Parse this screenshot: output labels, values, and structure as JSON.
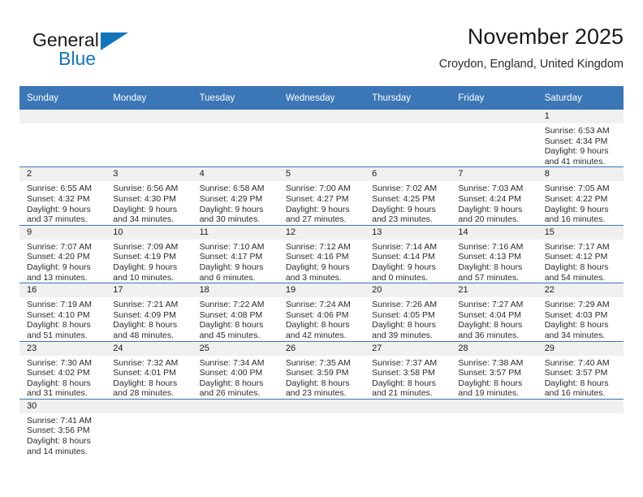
{
  "brand": {
    "name_line1": "General",
    "name_line2": "Blue",
    "accent_color": "#1275bc"
  },
  "header": {
    "title": "November 2025",
    "location": "Croydon, England, United Kingdom"
  },
  "theme": {
    "header_blue": "#3b76b6",
    "daynum_band": "#f0f0f0",
    "text": "#2b2b2b"
  },
  "weekdays": [
    "Sunday",
    "Monday",
    "Tuesday",
    "Wednesday",
    "Thursday",
    "Friday",
    "Saturday"
  ],
  "labels": {
    "sunrise": "Sunrise:",
    "sunset": "Sunset:",
    "daylight": "Daylight:"
  },
  "weeks": [
    [
      {
        "day": "",
        "sunrise": "",
        "sunset": "",
        "daylight_a": "",
        "daylight_b": ""
      },
      {
        "day": "",
        "sunrise": "",
        "sunset": "",
        "daylight_a": "",
        "daylight_b": ""
      },
      {
        "day": "",
        "sunrise": "",
        "sunset": "",
        "daylight_a": "",
        "daylight_b": ""
      },
      {
        "day": "",
        "sunrise": "",
        "sunset": "",
        "daylight_a": "",
        "daylight_b": ""
      },
      {
        "day": "",
        "sunrise": "",
        "sunset": "",
        "daylight_a": "",
        "daylight_b": ""
      },
      {
        "day": "",
        "sunrise": "",
        "sunset": "",
        "daylight_a": "",
        "daylight_b": ""
      },
      {
        "day": "1",
        "sunrise": "Sunrise: 6:53 AM",
        "sunset": "Sunset: 4:34 PM",
        "daylight_a": "Daylight: 9 hours",
        "daylight_b": "and 41 minutes."
      }
    ],
    [
      {
        "day": "2",
        "sunrise": "Sunrise: 6:55 AM",
        "sunset": "Sunset: 4:32 PM",
        "daylight_a": "Daylight: 9 hours",
        "daylight_b": "and 37 minutes."
      },
      {
        "day": "3",
        "sunrise": "Sunrise: 6:56 AM",
        "sunset": "Sunset: 4:30 PM",
        "daylight_a": "Daylight: 9 hours",
        "daylight_b": "and 34 minutes."
      },
      {
        "day": "4",
        "sunrise": "Sunrise: 6:58 AM",
        "sunset": "Sunset: 4:29 PM",
        "daylight_a": "Daylight: 9 hours",
        "daylight_b": "and 30 minutes."
      },
      {
        "day": "5",
        "sunrise": "Sunrise: 7:00 AM",
        "sunset": "Sunset: 4:27 PM",
        "daylight_a": "Daylight: 9 hours",
        "daylight_b": "and 27 minutes."
      },
      {
        "day": "6",
        "sunrise": "Sunrise: 7:02 AM",
        "sunset": "Sunset: 4:25 PM",
        "daylight_a": "Daylight: 9 hours",
        "daylight_b": "and 23 minutes."
      },
      {
        "day": "7",
        "sunrise": "Sunrise: 7:03 AM",
        "sunset": "Sunset: 4:24 PM",
        "daylight_a": "Daylight: 9 hours",
        "daylight_b": "and 20 minutes."
      },
      {
        "day": "8",
        "sunrise": "Sunrise: 7:05 AM",
        "sunset": "Sunset: 4:22 PM",
        "daylight_a": "Daylight: 9 hours",
        "daylight_b": "and 16 minutes."
      }
    ],
    [
      {
        "day": "9",
        "sunrise": "Sunrise: 7:07 AM",
        "sunset": "Sunset: 4:20 PM",
        "daylight_a": "Daylight: 9 hours",
        "daylight_b": "and 13 minutes."
      },
      {
        "day": "10",
        "sunrise": "Sunrise: 7:09 AM",
        "sunset": "Sunset: 4:19 PM",
        "daylight_a": "Daylight: 9 hours",
        "daylight_b": "and 10 minutes."
      },
      {
        "day": "11",
        "sunrise": "Sunrise: 7:10 AM",
        "sunset": "Sunset: 4:17 PM",
        "daylight_a": "Daylight: 9 hours",
        "daylight_b": "and 6 minutes."
      },
      {
        "day": "12",
        "sunrise": "Sunrise: 7:12 AM",
        "sunset": "Sunset: 4:16 PM",
        "daylight_a": "Daylight: 9 hours",
        "daylight_b": "and 3 minutes."
      },
      {
        "day": "13",
        "sunrise": "Sunrise: 7:14 AM",
        "sunset": "Sunset: 4:14 PM",
        "daylight_a": "Daylight: 9 hours",
        "daylight_b": "and 0 minutes."
      },
      {
        "day": "14",
        "sunrise": "Sunrise: 7:16 AM",
        "sunset": "Sunset: 4:13 PM",
        "daylight_a": "Daylight: 8 hours",
        "daylight_b": "and 57 minutes."
      },
      {
        "day": "15",
        "sunrise": "Sunrise: 7:17 AM",
        "sunset": "Sunset: 4:12 PM",
        "daylight_a": "Daylight: 8 hours",
        "daylight_b": "and 54 minutes."
      }
    ],
    [
      {
        "day": "16",
        "sunrise": "Sunrise: 7:19 AM",
        "sunset": "Sunset: 4:10 PM",
        "daylight_a": "Daylight: 8 hours",
        "daylight_b": "and 51 minutes."
      },
      {
        "day": "17",
        "sunrise": "Sunrise: 7:21 AM",
        "sunset": "Sunset: 4:09 PM",
        "daylight_a": "Daylight: 8 hours",
        "daylight_b": "and 48 minutes."
      },
      {
        "day": "18",
        "sunrise": "Sunrise: 7:22 AM",
        "sunset": "Sunset: 4:08 PM",
        "daylight_a": "Daylight: 8 hours",
        "daylight_b": "and 45 minutes."
      },
      {
        "day": "19",
        "sunrise": "Sunrise: 7:24 AM",
        "sunset": "Sunset: 4:06 PM",
        "daylight_a": "Daylight: 8 hours",
        "daylight_b": "and 42 minutes."
      },
      {
        "day": "20",
        "sunrise": "Sunrise: 7:26 AM",
        "sunset": "Sunset: 4:05 PM",
        "daylight_a": "Daylight: 8 hours",
        "daylight_b": "and 39 minutes."
      },
      {
        "day": "21",
        "sunrise": "Sunrise: 7:27 AM",
        "sunset": "Sunset: 4:04 PM",
        "daylight_a": "Daylight: 8 hours",
        "daylight_b": "and 36 minutes."
      },
      {
        "day": "22",
        "sunrise": "Sunrise: 7:29 AM",
        "sunset": "Sunset: 4:03 PM",
        "daylight_a": "Daylight: 8 hours",
        "daylight_b": "and 34 minutes."
      }
    ],
    [
      {
        "day": "23",
        "sunrise": "Sunrise: 7:30 AM",
        "sunset": "Sunset: 4:02 PM",
        "daylight_a": "Daylight: 8 hours",
        "daylight_b": "and 31 minutes."
      },
      {
        "day": "24",
        "sunrise": "Sunrise: 7:32 AM",
        "sunset": "Sunset: 4:01 PM",
        "daylight_a": "Daylight: 8 hours",
        "daylight_b": "and 28 minutes."
      },
      {
        "day": "25",
        "sunrise": "Sunrise: 7:34 AM",
        "sunset": "Sunset: 4:00 PM",
        "daylight_a": "Daylight: 8 hours",
        "daylight_b": "and 26 minutes."
      },
      {
        "day": "26",
        "sunrise": "Sunrise: 7:35 AM",
        "sunset": "Sunset: 3:59 PM",
        "daylight_a": "Daylight: 8 hours",
        "daylight_b": "and 23 minutes."
      },
      {
        "day": "27",
        "sunrise": "Sunrise: 7:37 AM",
        "sunset": "Sunset: 3:58 PM",
        "daylight_a": "Daylight: 8 hours",
        "daylight_b": "and 21 minutes."
      },
      {
        "day": "28",
        "sunrise": "Sunrise: 7:38 AM",
        "sunset": "Sunset: 3:57 PM",
        "daylight_a": "Daylight: 8 hours",
        "daylight_b": "and 19 minutes."
      },
      {
        "day": "29",
        "sunrise": "Sunrise: 7:40 AM",
        "sunset": "Sunset: 3:57 PM",
        "daylight_a": "Daylight: 8 hours",
        "daylight_b": "and 16 minutes."
      }
    ],
    [
      {
        "day": "30",
        "sunrise": "Sunrise: 7:41 AM",
        "sunset": "Sunset: 3:56 PM",
        "daylight_a": "Daylight: 8 hours",
        "daylight_b": "and 14 minutes."
      },
      {
        "day": "",
        "sunrise": "",
        "sunset": "",
        "daylight_a": "",
        "daylight_b": ""
      },
      {
        "day": "",
        "sunrise": "",
        "sunset": "",
        "daylight_a": "",
        "daylight_b": ""
      },
      {
        "day": "",
        "sunrise": "",
        "sunset": "",
        "daylight_a": "",
        "daylight_b": ""
      },
      {
        "day": "",
        "sunrise": "",
        "sunset": "",
        "daylight_a": "",
        "daylight_b": ""
      },
      {
        "day": "",
        "sunrise": "",
        "sunset": "",
        "daylight_a": "",
        "daylight_b": ""
      },
      {
        "day": "",
        "sunrise": "",
        "sunset": "",
        "daylight_a": "",
        "daylight_b": ""
      }
    ]
  ]
}
